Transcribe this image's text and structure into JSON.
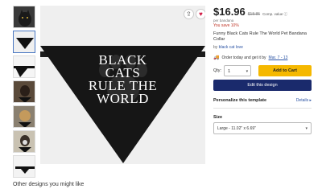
{
  "thumbnails": [
    {
      "name": "thumb-cat",
      "selected": false
    },
    {
      "name": "thumb-bandana-front",
      "selected": true
    },
    {
      "name": "thumb-bandana-side",
      "selected": false
    },
    {
      "name": "thumb-dog-1",
      "selected": false
    },
    {
      "name": "thumb-dog-2",
      "selected": false
    },
    {
      "name": "thumb-dog-3",
      "selected": false
    },
    {
      "name": "thumb-dog-4",
      "selected": false
    }
  ],
  "main_image": {
    "text_line1": "BLACK",
    "text_line2": "CATS",
    "text_line3": "RULE THE",
    "text_line4": "WORLD"
  },
  "product": {
    "price": "$16.96",
    "old_price": "$18.85",
    "price_note": "Comp. value ⓘ",
    "per": "per bandana",
    "save": "You save 10%",
    "title": "Funny Black Cats Rule The World Pet Bandana Collar",
    "by_prefix": "by",
    "by_store": "black cat love",
    "delivery_prefix": "Order today and get it by",
    "delivery_date": "Mar. 7 - 13"
  },
  "purchase": {
    "qty_label": "Qty:",
    "qty_value": "1",
    "add_to_cart": "Add to Cart",
    "edit_design": "Edit this design"
  },
  "personalize": {
    "title": "Personalize this template",
    "details": "Details ▸"
  },
  "size": {
    "label": "Size",
    "selected": "Large - 11.02\" x 6.69\""
  },
  "other_designs": "Other designs you might like"
}
